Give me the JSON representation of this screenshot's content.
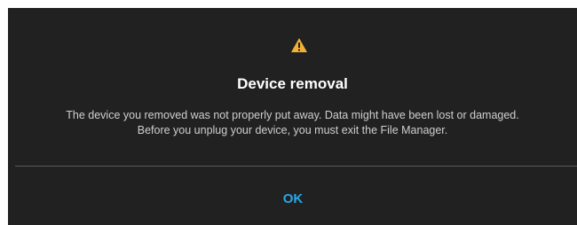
{
  "dialog": {
    "icon": "warning-icon",
    "title": "Device removal",
    "message_lines": [
      "The device you removed was not properly put away. Data might have been lost or damaged.",
      "Before you unplug your device, you must exit the File Manager."
    ],
    "ok_label": "OK"
  },
  "colors": {
    "background": "#212121",
    "title": "#ffffff",
    "text": "#cfcfcf",
    "divider": "#5a5a5a",
    "accent": "#2aa7e8",
    "warning": "#f2b134"
  }
}
